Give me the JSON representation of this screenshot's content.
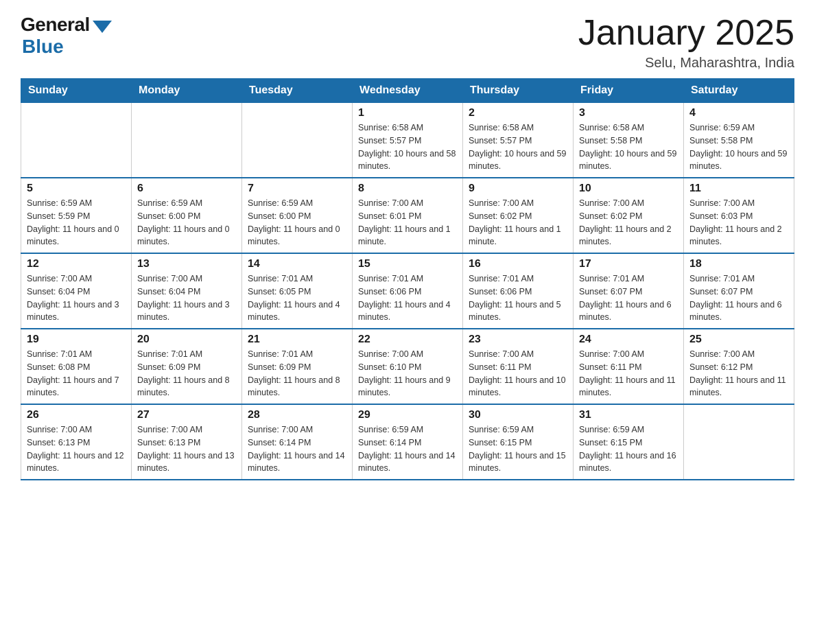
{
  "logo": {
    "general": "General",
    "blue": "Blue"
  },
  "title": "January 2025",
  "subtitle": "Selu, Maharashtra, India",
  "days_of_week": [
    "Sunday",
    "Monday",
    "Tuesday",
    "Wednesday",
    "Thursday",
    "Friday",
    "Saturday"
  ],
  "weeks": [
    [
      {
        "day": "",
        "info": ""
      },
      {
        "day": "",
        "info": ""
      },
      {
        "day": "",
        "info": ""
      },
      {
        "day": "1",
        "info": "Sunrise: 6:58 AM\nSunset: 5:57 PM\nDaylight: 10 hours and 58 minutes."
      },
      {
        "day": "2",
        "info": "Sunrise: 6:58 AM\nSunset: 5:57 PM\nDaylight: 10 hours and 59 minutes."
      },
      {
        "day": "3",
        "info": "Sunrise: 6:58 AM\nSunset: 5:58 PM\nDaylight: 10 hours and 59 minutes."
      },
      {
        "day": "4",
        "info": "Sunrise: 6:59 AM\nSunset: 5:58 PM\nDaylight: 10 hours and 59 minutes."
      }
    ],
    [
      {
        "day": "5",
        "info": "Sunrise: 6:59 AM\nSunset: 5:59 PM\nDaylight: 11 hours and 0 minutes."
      },
      {
        "day": "6",
        "info": "Sunrise: 6:59 AM\nSunset: 6:00 PM\nDaylight: 11 hours and 0 minutes."
      },
      {
        "day": "7",
        "info": "Sunrise: 6:59 AM\nSunset: 6:00 PM\nDaylight: 11 hours and 0 minutes."
      },
      {
        "day": "8",
        "info": "Sunrise: 7:00 AM\nSunset: 6:01 PM\nDaylight: 11 hours and 1 minute."
      },
      {
        "day": "9",
        "info": "Sunrise: 7:00 AM\nSunset: 6:02 PM\nDaylight: 11 hours and 1 minute."
      },
      {
        "day": "10",
        "info": "Sunrise: 7:00 AM\nSunset: 6:02 PM\nDaylight: 11 hours and 2 minutes."
      },
      {
        "day": "11",
        "info": "Sunrise: 7:00 AM\nSunset: 6:03 PM\nDaylight: 11 hours and 2 minutes."
      }
    ],
    [
      {
        "day": "12",
        "info": "Sunrise: 7:00 AM\nSunset: 6:04 PM\nDaylight: 11 hours and 3 minutes."
      },
      {
        "day": "13",
        "info": "Sunrise: 7:00 AM\nSunset: 6:04 PM\nDaylight: 11 hours and 3 minutes."
      },
      {
        "day": "14",
        "info": "Sunrise: 7:01 AM\nSunset: 6:05 PM\nDaylight: 11 hours and 4 minutes."
      },
      {
        "day": "15",
        "info": "Sunrise: 7:01 AM\nSunset: 6:06 PM\nDaylight: 11 hours and 4 minutes."
      },
      {
        "day": "16",
        "info": "Sunrise: 7:01 AM\nSunset: 6:06 PM\nDaylight: 11 hours and 5 minutes."
      },
      {
        "day": "17",
        "info": "Sunrise: 7:01 AM\nSunset: 6:07 PM\nDaylight: 11 hours and 6 minutes."
      },
      {
        "day": "18",
        "info": "Sunrise: 7:01 AM\nSunset: 6:07 PM\nDaylight: 11 hours and 6 minutes."
      }
    ],
    [
      {
        "day": "19",
        "info": "Sunrise: 7:01 AM\nSunset: 6:08 PM\nDaylight: 11 hours and 7 minutes."
      },
      {
        "day": "20",
        "info": "Sunrise: 7:01 AM\nSunset: 6:09 PM\nDaylight: 11 hours and 8 minutes."
      },
      {
        "day": "21",
        "info": "Sunrise: 7:01 AM\nSunset: 6:09 PM\nDaylight: 11 hours and 8 minutes."
      },
      {
        "day": "22",
        "info": "Sunrise: 7:00 AM\nSunset: 6:10 PM\nDaylight: 11 hours and 9 minutes."
      },
      {
        "day": "23",
        "info": "Sunrise: 7:00 AM\nSunset: 6:11 PM\nDaylight: 11 hours and 10 minutes."
      },
      {
        "day": "24",
        "info": "Sunrise: 7:00 AM\nSunset: 6:11 PM\nDaylight: 11 hours and 11 minutes."
      },
      {
        "day": "25",
        "info": "Sunrise: 7:00 AM\nSunset: 6:12 PM\nDaylight: 11 hours and 11 minutes."
      }
    ],
    [
      {
        "day": "26",
        "info": "Sunrise: 7:00 AM\nSunset: 6:13 PM\nDaylight: 11 hours and 12 minutes."
      },
      {
        "day": "27",
        "info": "Sunrise: 7:00 AM\nSunset: 6:13 PM\nDaylight: 11 hours and 13 minutes."
      },
      {
        "day": "28",
        "info": "Sunrise: 7:00 AM\nSunset: 6:14 PM\nDaylight: 11 hours and 14 minutes."
      },
      {
        "day": "29",
        "info": "Sunrise: 6:59 AM\nSunset: 6:14 PM\nDaylight: 11 hours and 14 minutes."
      },
      {
        "day": "30",
        "info": "Sunrise: 6:59 AM\nSunset: 6:15 PM\nDaylight: 11 hours and 15 minutes."
      },
      {
        "day": "31",
        "info": "Sunrise: 6:59 AM\nSunset: 6:15 PM\nDaylight: 11 hours and 16 minutes."
      },
      {
        "day": "",
        "info": ""
      }
    ]
  ]
}
